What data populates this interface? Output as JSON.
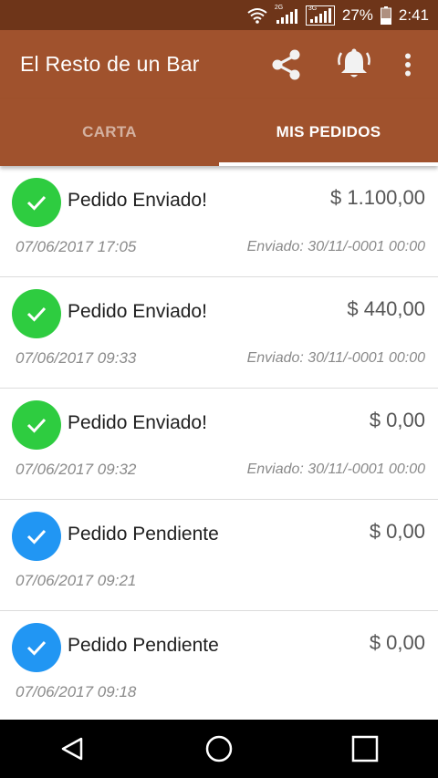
{
  "status_bar": {
    "battery": "27%",
    "time": "2:41",
    "network_tags": [
      "2G",
      "3G"
    ]
  },
  "app_bar": {
    "title": "El Resto de un Bar",
    "actions": [
      "share-icon",
      "notification-bell-icon",
      "more-vert-icon"
    ]
  },
  "tabs": [
    {
      "label": "CARTA",
      "active": false
    },
    {
      "label": "MIS PEDIDOS",
      "active": true
    }
  ],
  "colors": {
    "status_bar": "#6e3519",
    "app_bar": "#a0522d",
    "sent_badge": "#2ecc40",
    "pending_badge": "#2196f3"
  },
  "orders": [
    {
      "status": "Pedido Enviado!",
      "amount": "$ 1.100,00",
      "date": "07/06/2017 17:05",
      "sent": "Enviado: 30/11/-0001 00:00",
      "state": "sent"
    },
    {
      "status": "Pedido Enviado!",
      "amount": "$ 440,00",
      "date": "07/06/2017 09:33",
      "sent": "Enviado: 30/11/-0001 00:00",
      "state": "sent"
    },
    {
      "status": "Pedido Enviado!",
      "amount": "$ 0,00",
      "date": "07/06/2017 09:32",
      "sent": "Enviado: 30/11/-0001 00:00",
      "state": "sent"
    },
    {
      "status": "Pedido Pendiente",
      "amount": "$ 0,00",
      "date": "07/06/2017 09:21",
      "sent": "",
      "state": "pending"
    },
    {
      "status": "Pedido Pendiente",
      "amount": "$ 0,00",
      "date": "07/06/2017 09:18",
      "sent": "",
      "state": "pending"
    }
  ],
  "nav_bar": [
    "back-icon",
    "home-icon",
    "recents-icon"
  ]
}
